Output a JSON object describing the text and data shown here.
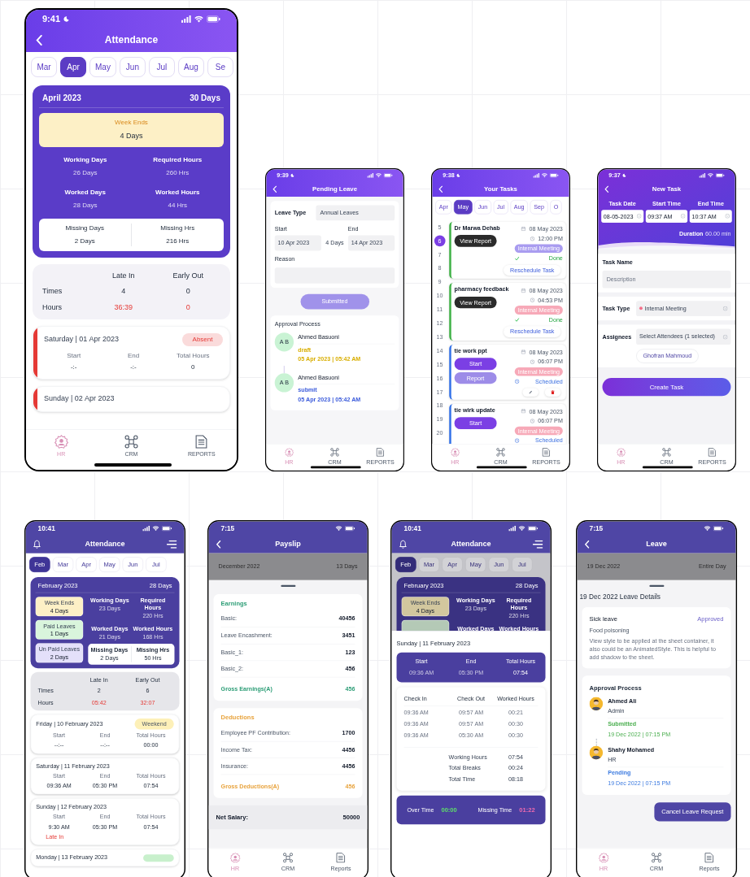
{
  "screens": [
    {
      "kind": "attendance",
      "status_time": "9:41",
      "title": "Attendance",
      "months": [
        {
          "label": "Mar",
          "selected": false
        },
        {
          "label": "Apr",
          "selected": true
        },
        {
          "label": "May",
          "selected": false
        },
        {
          "label": "Jun",
          "selected": false
        },
        {
          "label": "Jul",
          "selected": false
        },
        {
          "label": "Aug",
          "selected": false
        },
        {
          "label": "Se",
          "selected": false
        }
      ],
      "summary": {
        "month": "April 2023",
        "days": "30 Days",
        "highlights": [
          {
            "label": "Week Ends",
            "value": "4 Days",
            "color": "#fdf0c6"
          }
        ],
        "stats": [
          {
            "label": "Working Days",
            "value": "26 Days"
          },
          {
            "label": "Required Hours",
            "value": "260 Hrs"
          },
          {
            "label": "Worked Days",
            "value": "28 Days"
          },
          {
            "label": "Worked Hours",
            "value": "44 Hrs"
          }
        ],
        "missing": [
          {
            "label": "Missing Days",
            "value": "2 Days"
          },
          {
            "label": "Missing Hrs",
            "value": "216 Hrs"
          }
        ]
      },
      "late_early": {
        "columns": [
          "Late In",
          "Early Out"
        ],
        "rows": [
          {
            "label": "Times",
            "values": [
              "4",
              "0"
            ],
            "alert": false
          },
          {
            "label": "Hours",
            "values": [
              "36:39",
              "0"
            ],
            "alert": true
          }
        ]
      },
      "days": [
        {
          "title": "Saturday | 01 Apr 2023",
          "badge": "Absent",
          "color": "#e53935",
          "columns": [
            "Start",
            "End",
            "Total Hours"
          ],
          "values": [
            "-:-",
            "-:-",
            "0"
          ]
        },
        {
          "title": "Sunday | 02 Apr 2023",
          "color": "#e53935"
        }
      ],
      "tab_bar": [
        {
          "label": "HR",
          "selected": true
        },
        {
          "label": "CRM",
          "selected": false
        },
        {
          "label": "REPORTS",
          "selected": false
        }
      ]
    },
    {
      "kind": "pending_leave",
      "status_time": "9:39",
      "title": "Pending Leave",
      "leave_type": {
        "label": "Leave Type",
        "value": "Annual Leaves"
      },
      "start": {
        "label": "Start",
        "value": "10 Apr 2023"
      },
      "duration": "4 Days",
      "end": {
        "label": "End",
        "value": "14 Apr 2023"
      },
      "reason": {
        "label": "Reason"
      },
      "submit": {
        "label": "Submitted",
        "disabled": true
      },
      "approval": {
        "title": "Approval Process",
        "steps": [
          {
            "initials": "A B",
            "name": "Ahmed Basuoni",
            "status": "draft",
            "date": "05 Apr 2023 | 05:42 AM",
            "color": "#d9ae00"
          },
          {
            "initials": "A B",
            "name": "Ahmed Basuoni",
            "status": "submit",
            "date": "05 Apr 2023 | 05:42 AM",
            "color": "#3b5bdb"
          }
        ]
      },
      "tab_bar": [
        {
          "label": "HR",
          "selected": true
        },
        {
          "label": "CRM",
          "selected": false
        },
        {
          "label": "REPORTS",
          "selected": false
        }
      ]
    },
    {
      "kind": "tasks",
      "status_time": "9:38",
      "title": "Your Tasks",
      "months": [
        {
          "label": "Apr",
          "selected": false
        },
        {
          "label": "May",
          "selected": true
        },
        {
          "label": "Jun",
          "selected": false
        },
        {
          "label": "Jul",
          "selected": false
        },
        {
          "label": "Aug",
          "selected": false
        },
        {
          "label": "Sep",
          "selected": false
        },
        {
          "label": "O",
          "selected": false
        }
      ],
      "days": [
        {
          "label": "5",
          "selected": false
        },
        {
          "label": "6",
          "selected": true
        },
        {
          "label": "7",
          "selected": false
        },
        {
          "label": "8",
          "selected": false
        },
        {
          "label": "9",
          "selected": false
        },
        {
          "label": "10",
          "selected": false
        },
        {
          "label": "11",
          "selected": false
        },
        {
          "label": "12",
          "selected": false
        },
        {
          "label": "13",
          "selected": false
        },
        {
          "label": "14",
          "selected": false
        },
        {
          "label": "15",
          "selected": false
        },
        {
          "label": "16",
          "selected": false
        },
        {
          "label": "17",
          "selected": false
        },
        {
          "label": "18",
          "selected": false
        },
        {
          "label": "19",
          "selected": false
        },
        {
          "label": "20",
          "selected": false
        }
      ],
      "tasks": [
        {
          "title": "Dr Marwa Dehab",
          "color": "#3cb043",
          "date": "08 May 2023",
          "time": "12:00 PM",
          "tag": {
            "label": "Internal Meeting",
            "color": "#a99cf0"
          },
          "status": {
            "label": "Done",
            "kind": "done"
          },
          "actions": [
            {
              "label": "View Report",
              "kind": "dark"
            }
          ],
          "reschedule": "Reschedule Task",
          "editable": false
        },
        {
          "title": "pharmacy feedback",
          "color": "#3cb043",
          "date": "08 May 2023",
          "time": "04:53 PM",
          "tag": {
            "label": "Internal Meeting",
            "color": "#f7a9b8"
          },
          "status": {
            "label": "Done",
            "kind": "done"
          },
          "actions": [
            {
              "label": "View Report",
              "kind": "dark"
            }
          ],
          "reschedule": "Reschedule Task",
          "editable": false
        },
        {
          "title": "tie work ppt",
          "color": "#2f6fe8",
          "date": "08 May 2023",
          "time": "06:07 PM",
          "tag": {
            "label": "Internal Meeting",
            "color": "#f7a9b8"
          },
          "status": {
            "label": "Scheduled",
            "kind": "scheduled"
          },
          "actions": [
            {
              "label": "Start",
              "kind": "primary"
            },
            {
              "label": "Report",
              "kind": "muted"
            }
          ],
          "editable": true
        },
        {
          "title": "tie wirk update",
          "color": "#2f6fe8",
          "date": "08 May 2023",
          "time": "06:07 PM",
          "tag": {
            "label": "Internal Meeting",
            "color": "#f7a9b8"
          },
          "status": {
            "label": "Scheduled",
            "kind": "scheduled"
          },
          "actions": [
            {
              "label": "Start",
              "kind": "primary"
            }
          ],
          "editable": false
        }
      ],
      "tab_bar": [
        {
          "label": "HR",
          "selected": true
        },
        {
          "label": "CRM",
          "selected": false
        },
        {
          "label": "REPORTS",
          "selected": false
        }
      ]
    },
    {
      "kind": "new_task",
      "status_time": "9:37",
      "title": "New Task",
      "times": [
        {
          "label": "Task Date",
          "value": "08-05-2023"
        },
        {
          "label": "Start Time",
          "value": "09:37 AM"
        },
        {
          "label": "End Time",
          "value": "10:37 AM"
        }
      ],
      "duration": {
        "label": "Duration",
        "value": "60.00 min"
      },
      "task_name": {
        "label": "Task Name",
        "placeholder": "Description"
      },
      "task_type": {
        "label": "Task Type",
        "value": "Internal Meeting",
        "color": "#f4708a"
      },
      "assignees": {
        "label": "Assignees",
        "value": "Select Attendees (1 selected)",
        "chips": [
          "Ghofran Mahmoud"
        ]
      },
      "button": "Create Task",
      "tab_bar": [
        {
          "label": "HR",
          "selected": true
        },
        {
          "label": "CRM",
          "selected": false
        },
        {
          "label": "REPORTS",
          "selected": false
        }
      ]
    },
    {
      "kind": "attendance",
      "status_time": "10:41",
      "title": "Attendance",
      "months": [
        {
          "label": "Feb",
          "selected": true
        },
        {
          "label": "Mar",
          "selected": false
        },
        {
          "label": "Apr",
          "selected": false
        },
        {
          "label": "May",
          "selected": false
        },
        {
          "label": "Jun",
          "selected": false
        },
        {
          "label": "Jul",
          "selected": false
        }
      ],
      "summary": {
        "month": "February 2023",
        "days": "28 Days",
        "highlights": [
          {
            "label": "Week Ends",
            "value": "4 Days",
            "color": "#fdf0c6"
          },
          {
            "label": "Paid Leaves",
            "value": "1 Days",
            "color": "#d9f5dc"
          },
          {
            "label": "Un Paid Leaves",
            "value": "2 Days",
            "color": "#e4e0fa"
          }
        ],
        "stats": [
          {
            "label": "Working Days",
            "value": "23 Days"
          },
          {
            "label": "Required Hours",
            "value": "220 Hrs"
          },
          {
            "label": "Worked Days",
            "value": "21 Days"
          },
          {
            "label": "Worked Hours",
            "value": "168 Hrs"
          }
        ],
        "missing": [
          {
            "label": "Missing Days",
            "value": "2 Days"
          },
          {
            "label": "Missing Hrs",
            "value": "50 Hrs"
          }
        ]
      },
      "late_early": {
        "columns": [
          "Late In",
          "Early Out"
        ],
        "rows": [
          {
            "label": "Times",
            "values": [
              "2",
              "6"
            ],
            "alert": false
          },
          {
            "label": "Hours",
            "values": [
              "05:42",
              "32:07"
            ],
            "alert": true
          }
        ]
      },
      "days": [
        {
          "title": "Friday | 10 February 2023",
          "badge": "Weekend",
          "color": "#fdf0b8",
          "columns": [
            "Start",
            "End",
            "Total Hours"
          ],
          "values": [
            "--:--",
            "--:--",
            "00:00"
          ]
        },
        {
          "title": "Saturday | 11 February 2023",
          "columns": [
            "Start",
            "End",
            "Total Hours"
          ],
          "values": [
            "09:36 AM",
            "05:30 PM",
            "07:54"
          ]
        },
        {
          "title": "Sunday | 12 February 2023",
          "columns": [
            "Start",
            "End",
            "Total Hours"
          ],
          "values": [
            "9:30 AM",
            "05:30 PM",
            "07:54"
          ],
          "note": "Late In"
        },
        {
          "title": "Monday | 13 February 2023",
          "color": "#c8f0cc"
        }
      ]
    },
    {
      "kind": "payslip",
      "status_time": "7:15",
      "title": "Payslip",
      "month": {
        "label": "December 2022",
        "days": "13 Days"
      },
      "sections": [
        {
          "title": "Earnings",
          "color": "#2e9e77",
          "rows": [
            {
              "label": "Basic:",
              "value": "40456"
            },
            {
              "label": "Leave Encashment:",
              "value": "3451"
            },
            {
              "label": "Basic_1:",
              "value": "123"
            },
            {
              "label": "Basic_2:",
              "value": "456"
            }
          ],
          "total": {
            "label": "Gross Earnings(A)",
            "value": "456"
          }
        },
        {
          "title": "Deductions",
          "color": "#e8a33d",
          "rows": [
            {
              "label": "Employee PF Contribution:",
              "value": "1700"
            },
            {
              "label": "Income Tax:",
              "value": "4456"
            },
            {
              "label": "Insurance:",
              "value": "4456"
            }
          ],
          "total": {
            "label": "Gross Deductions(A)",
            "value": "456"
          }
        }
      ],
      "net": {
        "label": "Net Salary:",
        "value": "50000"
      },
      "tab_bar": [
        {
          "label": "HR",
          "selected": true
        },
        {
          "label": "CRM",
          "selected": false
        },
        {
          "label": "Reports",
          "selected": false
        }
      ]
    },
    {
      "kind": "attendance_sheet",
      "status_time": "10:41",
      "title": "Attendance",
      "months": [
        {
          "label": "Feb",
          "selected": true
        },
        {
          "label": "Mar",
          "selected": false
        },
        {
          "label": "Apr",
          "selected": false
        },
        {
          "label": "May",
          "selected": false
        },
        {
          "label": "Jun",
          "selected": false
        },
        {
          "label": "Jul",
          "selected": false
        }
      ],
      "summary": {
        "month": "February 2023",
        "days": "28 Days",
        "highlights": [
          {
            "label": "Week Ends",
            "value": "4 Days",
            "color": "#d2c79e"
          },
          {
            "color": "#b4c9b6"
          }
        ],
        "stats": [
          {
            "label": "Working Days",
            "value": "23 Days"
          },
          {
            "label": "Required Hours",
            "value": "220 Hrs"
          },
          {
            "label": "Worked Days"
          },
          {
            "label": "Worked Hours"
          }
        ]
      },
      "detail": {
        "title": "Sunday | 11 February 2023",
        "columns": [
          "Start",
          "End",
          "Total Hours"
        ],
        "values": [
          "09:36 AM",
          "05:30 PM",
          "07:54"
        ],
        "log_columns": [
          "Check In",
          "Check Out",
          "Worked Hours"
        ],
        "log": [
          [
            "09:36 AM",
            "09:57 AM",
            "00:21"
          ],
          [
            "09:36 AM",
            "09:57 AM",
            "00:30"
          ],
          [
            "09:36 AM",
            "05:30 AM",
            "00:30"
          ]
        ],
        "totals": [
          {
            "label": "Working Hours",
            "value": "07:54"
          },
          {
            "label": "Total Breaks",
            "value": "00:24"
          },
          {
            "label": "Total Time",
            "value": "08:18"
          }
        ],
        "balance": [
          {
            "label": "Over Time",
            "value": "00:00",
            "color": "#5ee06a"
          },
          {
            "label": "Missing Time",
            "value": "01:22",
            "color": "#f06bb0"
          }
        ]
      }
    },
    {
      "kind": "leave_detail",
      "status_time": "7:15",
      "title": "Leave",
      "month": {
        "label": "19 Dec 2022",
        "days": "Entire Day"
      },
      "heading": "19 Dec 2022 Leave Details",
      "leave": {
        "type": "Sick leave",
        "status": "Approved",
        "reason": "Food poisoning",
        "description": "View style to be applied at the sheet container, it also could be an AnimatedStyle. This is helpful to add shadow to the sheet."
      },
      "approval": {
        "title": "Approval Process",
        "steps": [
          {
            "name": "Ahmed Ali",
            "role": "Admin",
            "status": "Submitted",
            "date": "19 Dec 2022 | 07:15 PM",
            "color": "#4caf50"
          },
          {
            "name": "Shahy Mohamed",
            "role": "HR",
            "status": "Pending",
            "date": "19 Dec 2022 | 07:15 PM",
            "color": "#3d7be0"
          }
        ]
      },
      "button": "Cancel Leave Request",
      "tab_bar": [
        {
          "label": "HR",
          "selected": true
        },
        {
          "label": "CRM",
          "selected": false
        },
        {
          "label": "Reports",
          "selected": false
        }
      ]
    }
  ]
}
